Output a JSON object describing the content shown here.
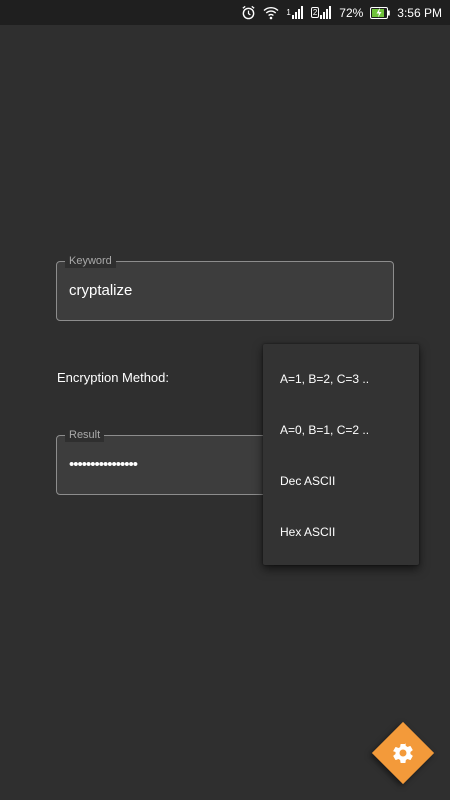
{
  "status_bar": {
    "icons": [
      "alarm-icon",
      "wifi-icon",
      "signal-1-icon",
      "signal-2-icon",
      "battery-charging-icon"
    ],
    "sim1": "1",
    "sim2": "2",
    "battery": "72%",
    "time": "3:56 PM"
  },
  "keyword": {
    "label": "Keyword",
    "value": "cryptalize"
  },
  "method": {
    "label": "Encryption Method:",
    "options": [
      "A=1, B=2, C=3 ..",
      "A=0, B=1, C=2 ..",
      "Dec ASCII",
      "Hex ASCII"
    ]
  },
  "result": {
    "label": "Result",
    "value": "••••••••••••••••"
  },
  "fab": {
    "icon": "gear-icon",
    "color": "#f39a3a"
  }
}
